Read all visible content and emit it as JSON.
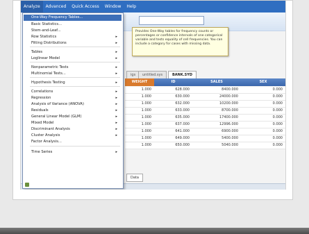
{
  "menubar": {
    "items": [
      {
        "label": "Analyze",
        "active": true
      },
      {
        "label": "Advanced"
      },
      {
        "label": "Quick Access"
      },
      {
        "label": "Window"
      },
      {
        "label": "Help"
      }
    ]
  },
  "menu": {
    "items": [
      {
        "label": "One-Way Frequency Tables...",
        "highlighted": true
      },
      {
        "label": "Basic Statistics..."
      },
      {
        "label": "Stem-and-Leaf..."
      },
      {
        "label": "Row Statistics",
        "submenu": true
      },
      {
        "label": "Fitting Distributions",
        "submenu": true
      },
      {
        "label": "Tables",
        "submenu": true
      },
      {
        "label": "Loglinear Model",
        "submenu": true
      },
      {
        "label": "Nonparametric Tests",
        "submenu": true
      },
      {
        "label": "Multinomial Tests...",
        "submenu": true
      },
      {
        "label": "Hypothesis Testing",
        "submenu": true
      },
      {
        "label": "Correlations",
        "submenu": true
      },
      {
        "label": "Regression",
        "submenu": true
      },
      {
        "label": "Analysis of Variance (ANOVA)",
        "submenu": true
      },
      {
        "label": "Residuals",
        "submenu": true
      },
      {
        "label": "General Linear Model (GLM)",
        "submenu": true
      },
      {
        "label": "Mixed Model",
        "submenu": true
      },
      {
        "label": "Discriminant Analysis",
        "submenu": true
      },
      {
        "label": "Cluster Analysis",
        "submenu": true
      },
      {
        "label": "Factor Analysis..."
      },
      {
        "label": "Time Series",
        "submenu": true
      }
    ]
  },
  "tooltip": {
    "text": "Provides One-Way tables for frequency counts or percentages or confidence intervals of one categorical variable and tests equality of cell frequencies. You can include a category for cases with missing data."
  },
  "tabs": [
    {
      "label": "igs"
    },
    {
      "label": "untitled.sys"
    },
    {
      "label": "BANK.SYD",
      "active": true
    }
  ],
  "table": {
    "columns": [
      "WEIGHT",
      "ID",
      "SALES",
      "SEX"
    ],
    "rows": [
      [
        "1.000",
        "628.000",
        "8400.000",
        "0.000"
      ],
      [
        "1.000",
        "630.000",
        "24000.000",
        "0.000"
      ],
      [
        "1.000",
        "632.000",
        "10200.000",
        "0.000"
      ],
      [
        "1.000",
        "633.000",
        "8700.000",
        "0.000"
      ],
      [
        "1.000",
        "635.000",
        "17400.000",
        "0.000"
      ],
      [
        "1.000",
        "637.000",
        "12996.000",
        "0.000"
      ],
      [
        "1.000",
        "641.000",
        "6900.000",
        "0.000"
      ],
      [
        "1.000",
        "649.000",
        "5400.000",
        "0.000"
      ],
      [
        "1.000",
        "650.000",
        "5040.000",
        "0.000"
      ]
    ]
  },
  "sheet_tab": {
    "label": "Data"
  },
  "colors": {
    "menubar": "#2f6ec1",
    "highlight": "#3d6fb8",
    "header": "#3b67ac",
    "weight_header": "#d97a2d"
  }
}
